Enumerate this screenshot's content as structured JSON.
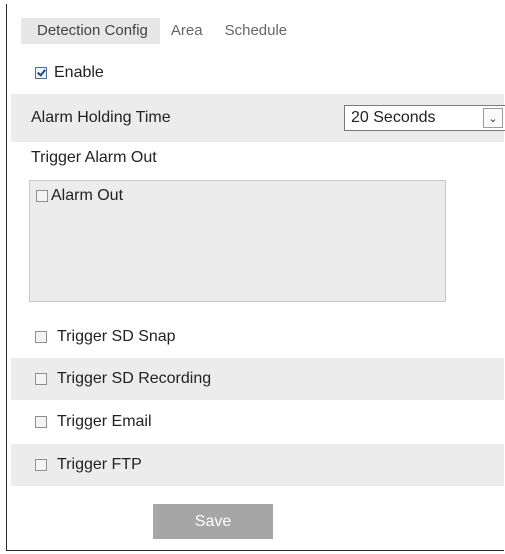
{
  "tabs": [
    {
      "label": "Detection Config",
      "active": true
    },
    {
      "label": "Area",
      "active": false
    },
    {
      "label": "Schedule",
      "active": false
    }
  ],
  "enable": {
    "label": "Enable",
    "checked": true
  },
  "alarm_holding": {
    "label": "Alarm Holding Time",
    "value": "20 Seconds",
    "arrow_icon": "chevron-down-icon"
  },
  "trigger_alarm_out": {
    "label": "Trigger Alarm Out"
  },
  "alarm_out": {
    "label": "Alarm Out",
    "checked": false
  },
  "triggers": [
    {
      "label": "Trigger SD Snap",
      "checked": false
    },
    {
      "label": "Trigger SD Recording",
      "checked": false
    },
    {
      "label": "Trigger Email",
      "checked": false
    },
    {
      "label": "Trigger FTP",
      "checked": false
    }
  ],
  "save_label": "Save",
  "colors": {
    "shade": "#ececec",
    "tab_active": "#e7e7e7",
    "save_button": "#a6a6a6",
    "text": "#222222"
  }
}
